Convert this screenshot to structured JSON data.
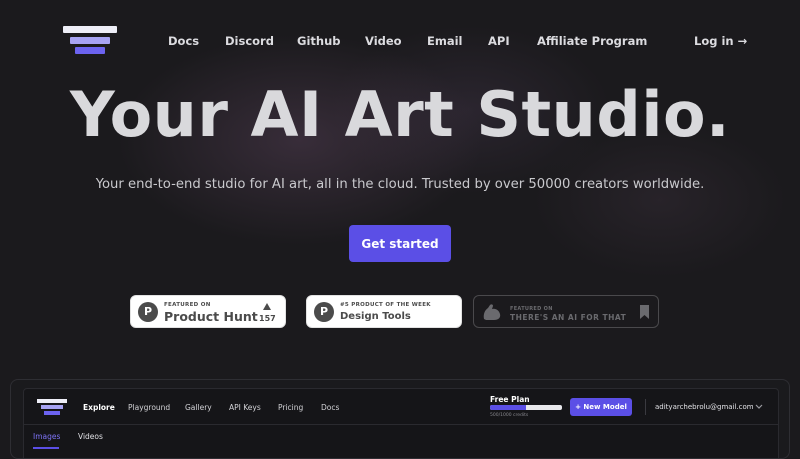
{
  "nav": {
    "items": [
      "Docs",
      "Discord",
      "Github",
      "Video",
      "Email",
      "API",
      "Affiliate Program"
    ],
    "login": "Log in →"
  },
  "hero": {
    "title": "Your AI Art Studio.",
    "subtitle": "Your end-to-end studio for AI art, all in the cloud. Trusted by over 50000 creators worldwide.",
    "cta": "Get started"
  },
  "badges": {
    "product_hunt": {
      "small": "FEATURED ON",
      "big": "Product Hunt",
      "votes": "157",
      "icon_letter": "P"
    },
    "design_tools": {
      "small": "#5 PRODUCT OF THE WEEK",
      "big": "Design Tools",
      "icon_letter": "P"
    },
    "ai_for_that": {
      "small": "FEATURED ON",
      "big": "THERE'S AN AI FOR THAT"
    }
  },
  "preview": {
    "nav": [
      "Explore",
      "Playground",
      "Gallery",
      "API Keys",
      "Pricing",
      "Docs"
    ],
    "active_nav": "Explore",
    "plan": {
      "label": "Free Plan",
      "credits": "500/1000 credits",
      "fraction": 0.5
    },
    "new_model": "+ New Model",
    "email": "adityarchebrolu@gmail.com",
    "tabs": [
      "Images",
      "Videos"
    ],
    "active_tab": "Images"
  },
  "colors": {
    "accent": "#5b4fe6",
    "background": "#1b1a1d"
  }
}
